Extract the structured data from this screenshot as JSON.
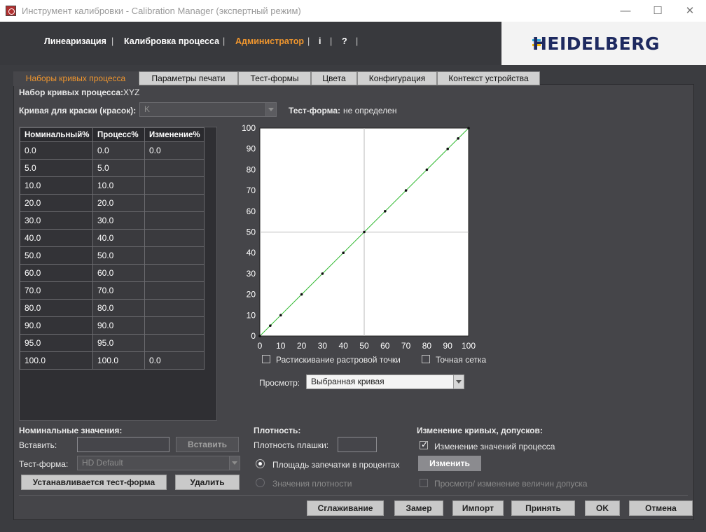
{
  "window": {
    "title": "Инструмент калибровки - Calibration Manager (экспертный режим)",
    "minimize": "—",
    "maximize": "☐",
    "close": "✕"
  },
  "menu": {
    "items": [
      "Линеаризация",
      "Калибровка процесса",
      "Администратор",
      "i",
      "?"
    ],
    "active_index": 2,
    "separator": "|"
  },
  "brand": {
    "logo_text": "HEIDELBERG",
    "accent": "#f0962e",
    "logo_color": "#1e2a60"
  },
  "tabs": [
    "Наборы кривых процесса",
    "Параметры печати",
    "Тест-формы",
    "Цвета",
    "Конфигурация",
    "Контекст устройства"
  ],
  "curve_set": {
    "label": "Набор кривых процесса:",
    "value": "XYZ"
  },
  "ink_curve": {
    "label": "Кривая для краски (красок):",
    "value": "K"
  },
  "test_form_status": {
    "label": "Тест-форма:",
    "value": "не определен"
  },
  "table": {
    "headers": [
      "Номинальный%",
      "Процесс%",
      "Изменение%"
    ],
    "rows": [
      [
        "0.0",
        "0.0",
        "0.0"
      ],
      [
        "5.0",
        "5.0",
        ""
      ],
      [
        "10.0",
        "10.0",
        ""
      ],
      [
        "20.0",
        "20.0",
        ""
      ],
      [
        "30.0",
        "30.0",
        ""
      ],
      [
        "40.0",
        "40.0",
        ""
      ],
      [
        "50.0",
        "50.0",
        ""
      ],
      [
        "60.0",
        "60.0",
        ""
      ],
      [
        "70.0",
        "70.0",
        ""
      ],
      [
        "80.0",
        "80.0",
        ""
      ],
      [
        "90.0",
        "90.0",
        ""
      ],
      [
        "95.0",
        "95.0",
        ""
      ],
      [
        "100.0",
        "100.0",
        "0.0"
      ]
    ]
  },
  "chart_data": {
    "type": "line",
    "x": [
      0,
      5,
      10,
      20,
      30,
      40,
      50,
      60,
      70,
      80,
      90,
      95,
      100
    ],
    "series": [
      {
        "values": [
          0,
          5,
          10,
          20,
          30,
          40,
          50,
          60,
          70,
          80,
          90,
          95,
          100
        ],
        "color": "#2eb82e"
      }
    ],
    "xlim": [
      0,
      100
    ],
    "ylim": [
      0,
      100
    ],
    "x_ticks": [
      0,
      10,
      20,
      30,
      40,
      50,
      60,
      70,
      80,
      90,
      100
    ],
    "y_ticks": [
      0,
      10,
      20,
      30,
      40,
      50,
      60,
      70,
      80,
      90,
      100
    ],
    "x_tick_labels": [
      "0",
      "10",
      "20",
      "30",
      "40",
      "50",
      "60",
      "70",
      "80",
      "90",
      "100"
    ],
    "y_tick_labels": [
      "0",
      "10",
      "20",
      "30",
      "40",
      "50",
      "60",
      "70",
      "80",
      "90",
      "100"
    ],
    "grid_lines": [
      50
    ],
    "grid": "center cross only"
  },
  "chart_options": {
    "dot_gain": {
      "label": "Растискивание растровой точки",
      "checked": false
    },
    "fine_grid": {
      "label": "Точная сетка",
      "checked": false
    }
  },
  "view": {
    "label": "Просмотр:",
    "value": "Выбранная кривая"
  },
  "nominal": {
    "title": "Номинальные значения:",
    "insert_label": "Вставить:",
    "insert_value": "",
    "insert_button": "Вставить",
    "testform_label": "Тест-форма:",
    "testform_value": "HD Default",
    "set_testform_button": "Устанавливается тест-форма",
    "delete_button": "Удалить"
  },
  "density": {
    "title": "Плотность:",
    "solid_label": "Плотность плашки:",
    "solid_value": "",
    "option_area": "Площадь запечатки в процентах",
    "option_density": "Значения плотности",
    "selected": "area"
  },
  "curve_change": {
    "title": "Изменение кривых, допусков:",
    "change_process_label": "Изменение значений процесса",
    "change_process_checked": true,
    "change_button": "Изменить",
    "tolerance_label": "Просмотр/ изменение величин допуска",
    "tolerance_checked": false
  },
  "footer_buttons": [
    "Сглаживание",
    "Замер",
    "Импорт",
    "Принять",
    "OK",
    "Отмена"
  ]
}
